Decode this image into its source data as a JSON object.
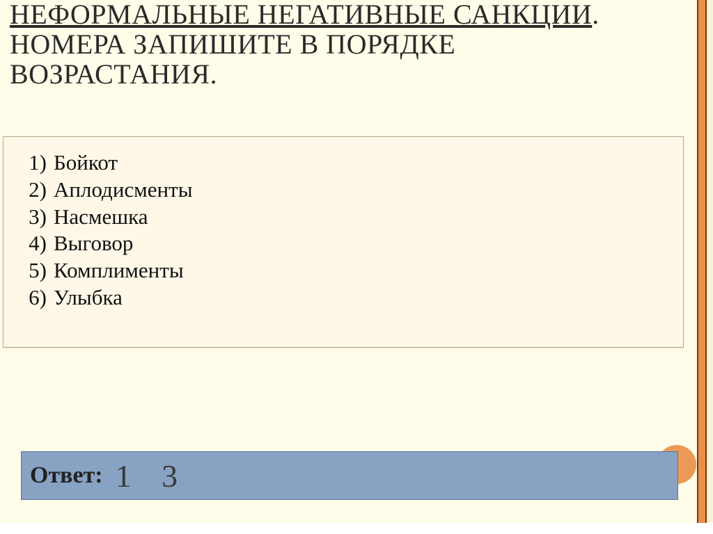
{
  "title": {
    "line_underlined": "НЕФОРМАЛЬНЫЕ НЕГАТИВНЫЕ САНКЦИИ",
    "rest": ". НОМЕРА ЗАПИШИТЕ В ПОРЯДКЕ ВОЗРАСТАНИЯ."
  },
  "options": [
    {
      "num": "1)",
      "text": "Бойкот"
    },
    {
      "num": "2)",
      "text": "Аплодисменты"
    },
    {
      "num": "3)",
      "text": "Насмешка"
    },
    {
      "num": "4)",
      "text": "Выговор"
    },
    {
      "num": "5)",
      "text": "Комплименты"
    },
    {
      "num": "6)",
      "text": "Улыбка"
    }
  ],
  "answer": {
    "label": "Ответ:",
    "value": "1  3"
  }
}
